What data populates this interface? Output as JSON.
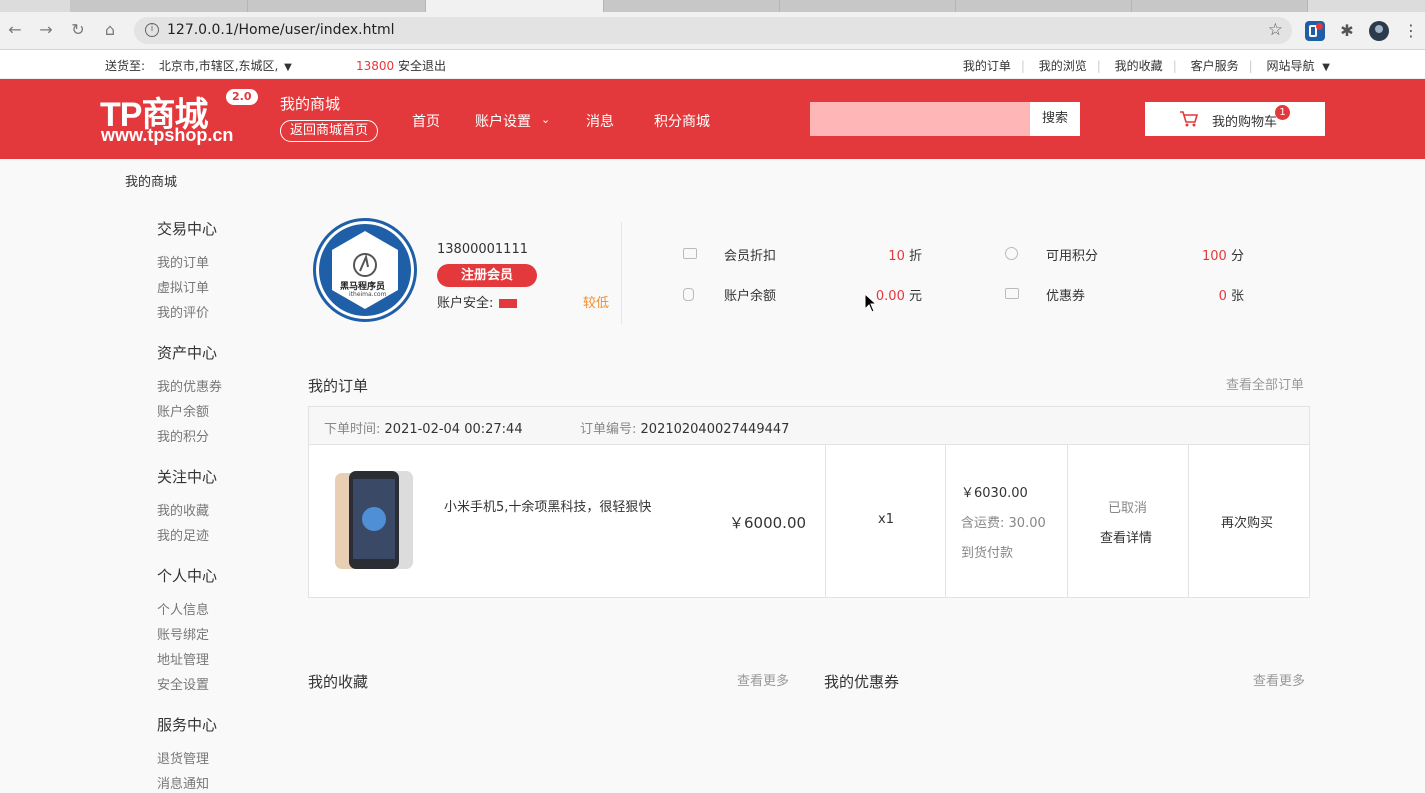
{
  "browser": {
    "url": "127.0.0.1/Home/user/index.html"
  },
  "topbar": {
    "ship_to_label": "送货至:",
    "region": "北京市,市辖区,东城区,",
    "user_phone": "13800",
    "logout": "安全退出",
    "links": [
      "我的订单",
      "我的浏览",
      "我的收藏",
      "客户服务",
      "网站导航"
    ]
  },
  "header": {
    "logo_text": "TP商城",
    "logo_version": "2.0",
    "logo_site": "www.tpshop.cn",
    "my_mall": "我的商城",
    "back_home": "返回商城首页",
    "nav": [
      "首页",
      "账户设置",
      "消息",
      "积分商城"
    ],
    "search_placeholder": "",
    "search_button": "搜索",
    "cart_label": "我的购物车",
    "cart_count": "1",
    "brand_color": "#e4393c"
  },
  "breadcrumb": "我的商城",
  "sidebar": {
    "groups": [
      {
        "title": "交易中心",
        "links": [
          "我的订单",
          "虚拟订单",
          "我的评价"
        ]
      },
      {
        "title": "资产中心",
        "links": [
          "我的优惠券",
          "账户余额",
          "我的积分"
        ]
      },
      {
        "title": "关注中心",
        "links": [
          "我的收藏",
          "我的足迹"
        ]
      },
      {
        "title": "个人中心",
        "links": [
          "个人信息",
          "账号绑定",
          "地址管理",
          "安全设置"
        ]
      },
      {
        "title": "服务中心",
        "links": [
          "退货管理",
          "消息通知"
        ]
      }
    ]
  },
  "profile": {
    "avatar_text": "黑马程序员",
    "avatar_sub": "itheima.com",
    "phone": "13800001111",
    "member_level": "注册会员",
    "security_label": "账户安全:",
    "security_level": "较低",
    "stats": [
      {
        "label": "会员折扣",
        "value": "10",
        "unit": "折",
        "icon": "card-icon"
      },
      {
        "label": "可用积分",
        "value": "100",
        "unit": "分",
        "icon": "coin-icon"
      },
      {
        "label": "账户余额",
        "value": "0.00",
        "unit": "元",
        "icon": "wallet-icon"
      },
      {
        "label": "优惠券",
        "value": "0",
        "unit": "张",
        "icon": "coupon-icon"
      }
    ]
  },
  "orders": {
    "title": "我的订单",
    "view_all": "查看全部订单",
    "order_time_label": "下单时间:",
    "order_time": "2021-02-04 00:27:44",
    "order_no_label": "订单编号:",
    "order_no": "202102040027449447",
    "product_name": "小米手机5,十余项黑科技，很轻狠快",
    "product_price": "￥6000.00",
    "quantity": "x1",
    "total": "￥6030.00",
    "shipping_label": "含运费:",
    "shipping": "30.00",
    "payment": "到货付款",
    "status": "已取消",
    "detail": "查看详情",
    "rebuy": "再次购买"
  },
  "favorites": {
    "title": "我的收藏",
    "more": "查看更多"
  },
  "coupons": {
    "title": "我的优惠券",
    "more": "查看更多"
  }
}
